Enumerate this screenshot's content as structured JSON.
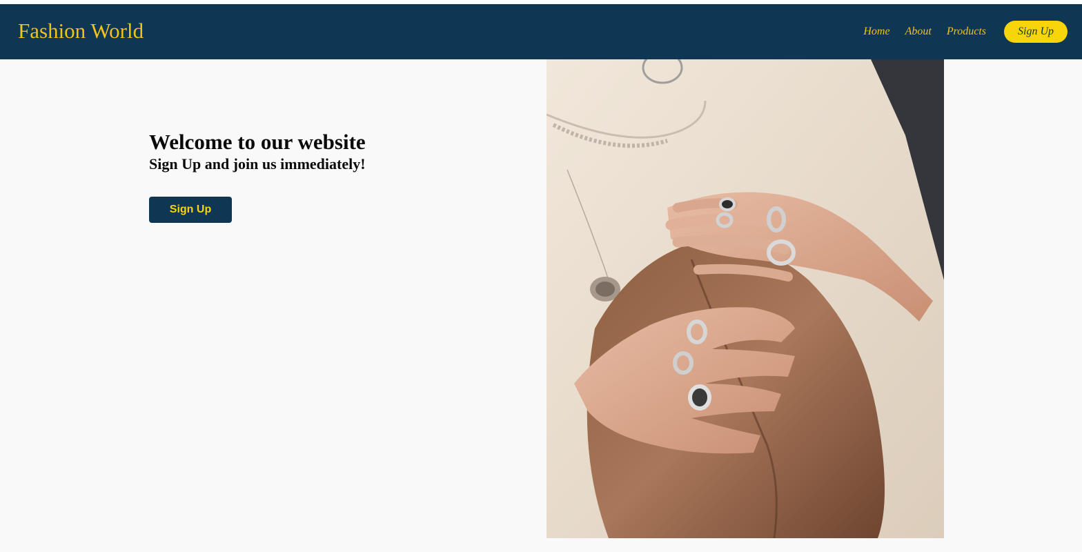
{
  "header": {
    "brand": "Fashion World",
    "nav": [
      {
        "label": "Home"
      },
      {
        "label": "About"
      },
      {
        "label": "Products"
      }
    ],
    "signup_label": "Sign Up"
  },
  "hero": {
    "title": "Welcome to our website",
    "subtitle": "Sign Up and join us immediately!",
    "button_label": "Sign Up"
  },
  "colors": {
    "navbar": "#0f3652",
    "accent": "#f2c318",
    "pill": "#f8d40a",
    "page_bg": "#f9f9f9"
  }
}
